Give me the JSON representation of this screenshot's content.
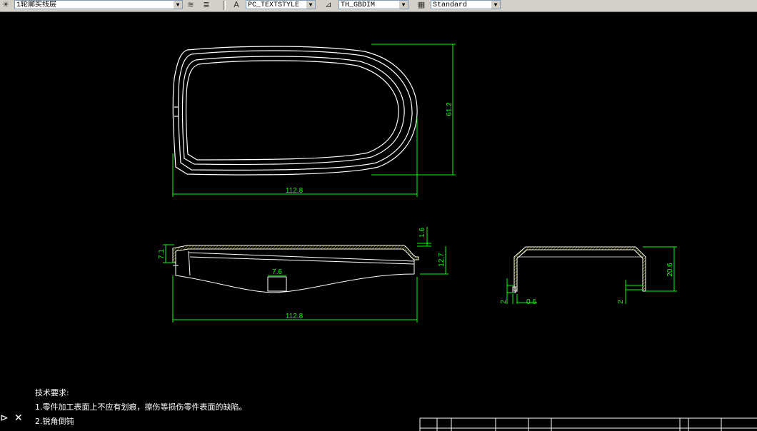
{
  "toolbar": {
    "layer_name": "1轮廓实线层",
    "text_style": "PC_TEXTSTYLE",
    "dim_style": "TH_GBDIM",
    "table_style": "Standard"
  },
  "drawing": {
    "top_view": {
      "width_dim": "112.8",
      "height_dim": "61.2"
    },
    "front_view": {
      "width_dim": "112.8",
      "thickness_dim": "1.6",
      "height_dim": "12.7",
      "left_dim": "7.1",
      "slot_dim": "7.6"
    },
    "side_view": {
      "height_dim": "20.6",
      "left_small_dim": "2",
      "wall_dim": "0.6",
      "right_small_dim": "2"
    }
  },
  "notes": {
    "heading": "技术要求:",
    "line1": "1.零件加工表面上不应有划痕，擦伤等损伤零件表面的缺陷。",
    "line2": "2.锐角倒钝"
  },
  "colors": {
    "geometry": "#ffffff",
    "dimension": "#00ff00",
    "hatch": "#c8c800"
  }
}
